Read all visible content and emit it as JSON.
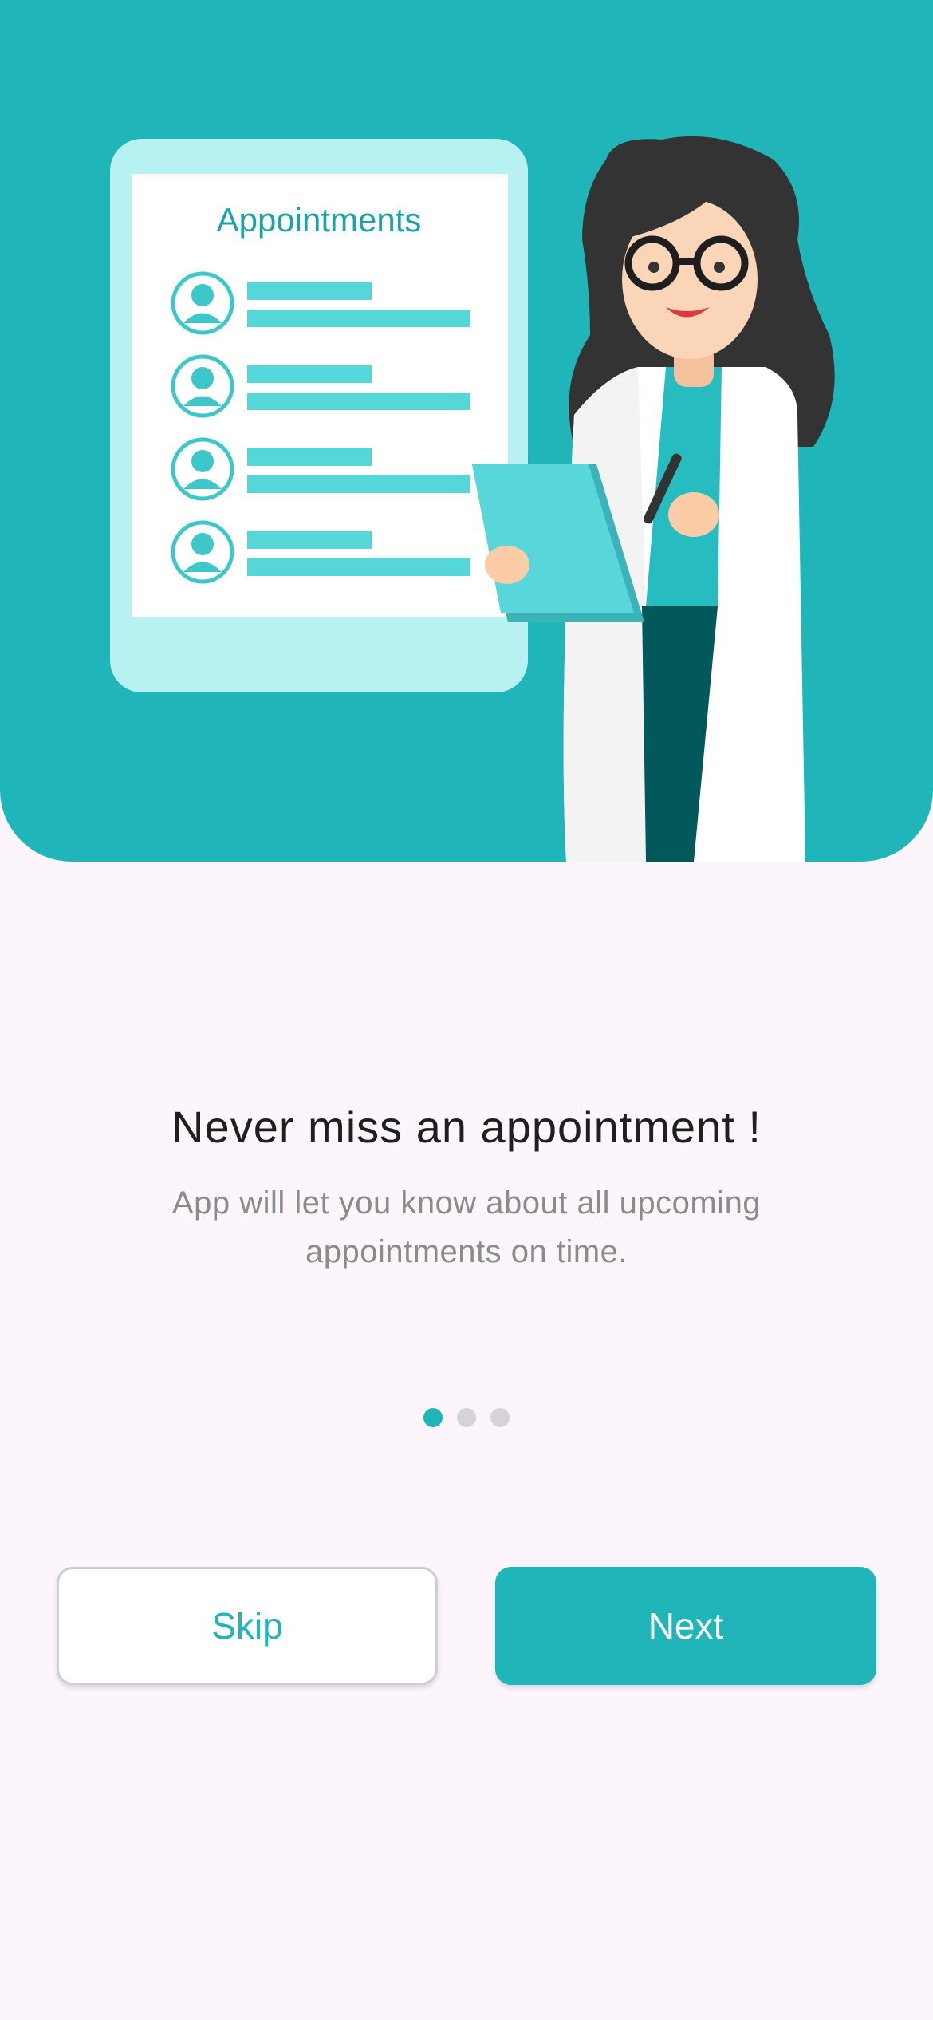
{
  "illustration": {
    "board_title": "Appointments",
    "row_count": 4
  },
  "onboarding": {
    "title": "Never miss an appointment !",
    "subtitle": "App will let you know about all upcoming appointments on time.",
    "page_indicator": {
      "total": 3,
      "current": 1
    }
  },
  "actions": {
    "skip_label": "Skip",
    "next_label": "Next"
  },
  "colors": {
    "accent": "#20b6b9",
    "background": "#fcf5fc"
  }
}
